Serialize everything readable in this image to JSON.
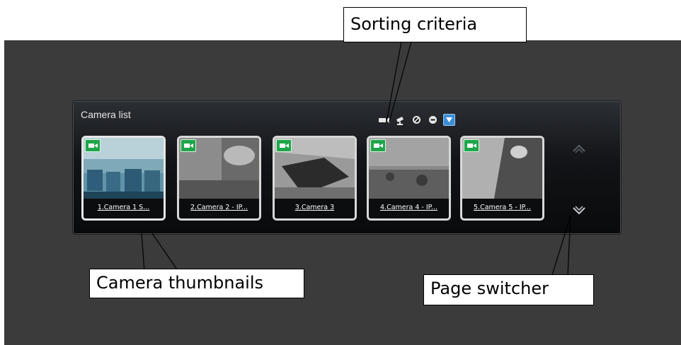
{
  "panel": {
    "title": "Camera list",
    "sort_icons": [
      "camera-sort-icon",
      "ptz-sort-icon",
      "disabled-sort-icon",
      "status-sort-icon",
      "filter-sort-icon"
    ]
  },
  "cameras": [
    {
      "label": "1.Camera 1 S..."
    },
    {
      "label": "2.Camera 2 - IP..."
    },
    {
      "label": "3.Camera 3"
    },
    {
      "label": "4.Camera 4 - IP..."
    },
    {
      "label": "5.Camera 5 - IP..."
    }
  ],
  "callouts": {
    "sorting": "Sorting criteria",
    "thumbnails": "Camera thumbnails",
    "pager": "Page switcher"
  },
  "colors": {
    "badge": "#1fa54a",
    "active_sort": "#3b8fd6",
    "background": "#3b3b3b"
  }
}
